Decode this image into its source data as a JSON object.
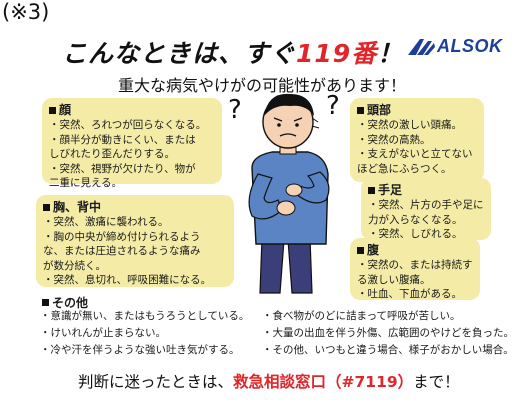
{
  "ref_label": "(※3)",
  "headline": {
    "before": "こんなときは、すぐ",
    "number": "119番",
    "after": "！"
  },
  "logo": {
    "text": "ALSOK",
    "color": "#1b3f9a"
  },
  "subhead": "重大な病気やけがの可能性があります！",
  "panels": {
    "face": {
      "title": "顔",
      "items": [
        "・突然、ろれつが回らなくなる。",
        "・顔半分が動きにくい、または\nしびれたり歪んだりする。",
        "・突然、視野が欠けたり、物が\n二重に見える。"
      ]
    },
    "chest": {
      "title": "胸、背中",
      "items": [
        "・突然、激痛に襲われる。",
        "・胸の中央が締め付けられるよう\nな、または圧迫されるような痛み\nが数分続く。",
        "・突然、息切れ、呼吸困難になる。"
      ]
    },
    "head": {
      "title": "頭部",
      "items": [
        "・突然の激しい頭痛。",
        "・突然の高熱。",
        "・支えがないと立てない\nほど急にふらつく。"
      ]
    },
    "limbs": {
      "title": "手足",
      "items": [
        "・突然、片方の手や足に\n力が入らなくなる。",
        "・突然、しびれる。"
      ]
    },
    "abdomen": {
      "title": "腹",
      "items": [
        "・突然の、または持続す\nる激しい腹痛。",
        "・吐血、下血がある。"
      ]
    }
  },
  "others": {
    "title": "その他",
    "left": [
      "・意識が無い、またはもうろうとしている。",
      "・けいれんが止まらない。",
      "・冷や汗を伴うような強い吐き気がする。"
    ],
    "right": [
      "・食べ物がのどに詰まって呼吸が苦しい。",
      "・大量の出血を伴う外傷、広範囲のやけどを負った。",
      "・その他、いつもと違う場合、様子がおかしい場合。"
    ]
  },
  "footer": {
    "before": "判断に迷ったときは、",
    "highlight": "救急相談窓口（#7119）",
    "after": "まで！"
  },
  "colors": {
    "panel_bg": "#f4eca6",
    "accent_red": "#e0262a",
    "shirt_blue": "#5b84c4"
  }
}
